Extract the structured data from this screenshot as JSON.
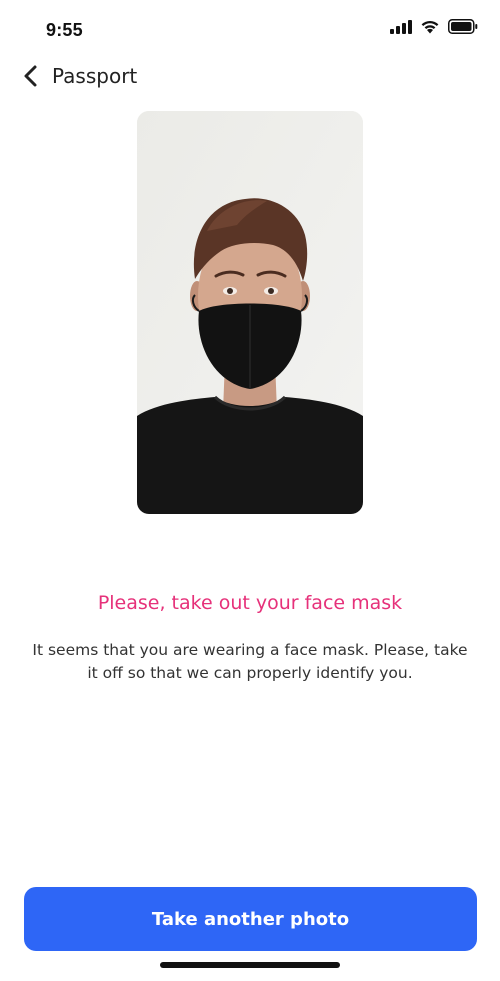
{
  "status_bar": {
    "time": "9:55",
    "icons": [
      "cellular-signal-icon",
      "wifi-icon",
      "battery-icon"
    ]
  },
  "header": {
    "back_icon": "chevron-left-icon",
    "title": "Passport"
  },
  "photo": {
    "description_icon": "captured-face-photo"
  },
  "alert": {
    "title": "Please, take out your face mask",
    "message": "It seems that you are wearing a face mask. Please, take it off so that we can properly identify you."
  },
  "actions": {
    "primary_label": "Take another photo"
  },
  "colors": {
    "accent_pink": "#e6317a",
    "button_blue": "#2e66f6",
    "text_dark": "#222222"
  }
}
